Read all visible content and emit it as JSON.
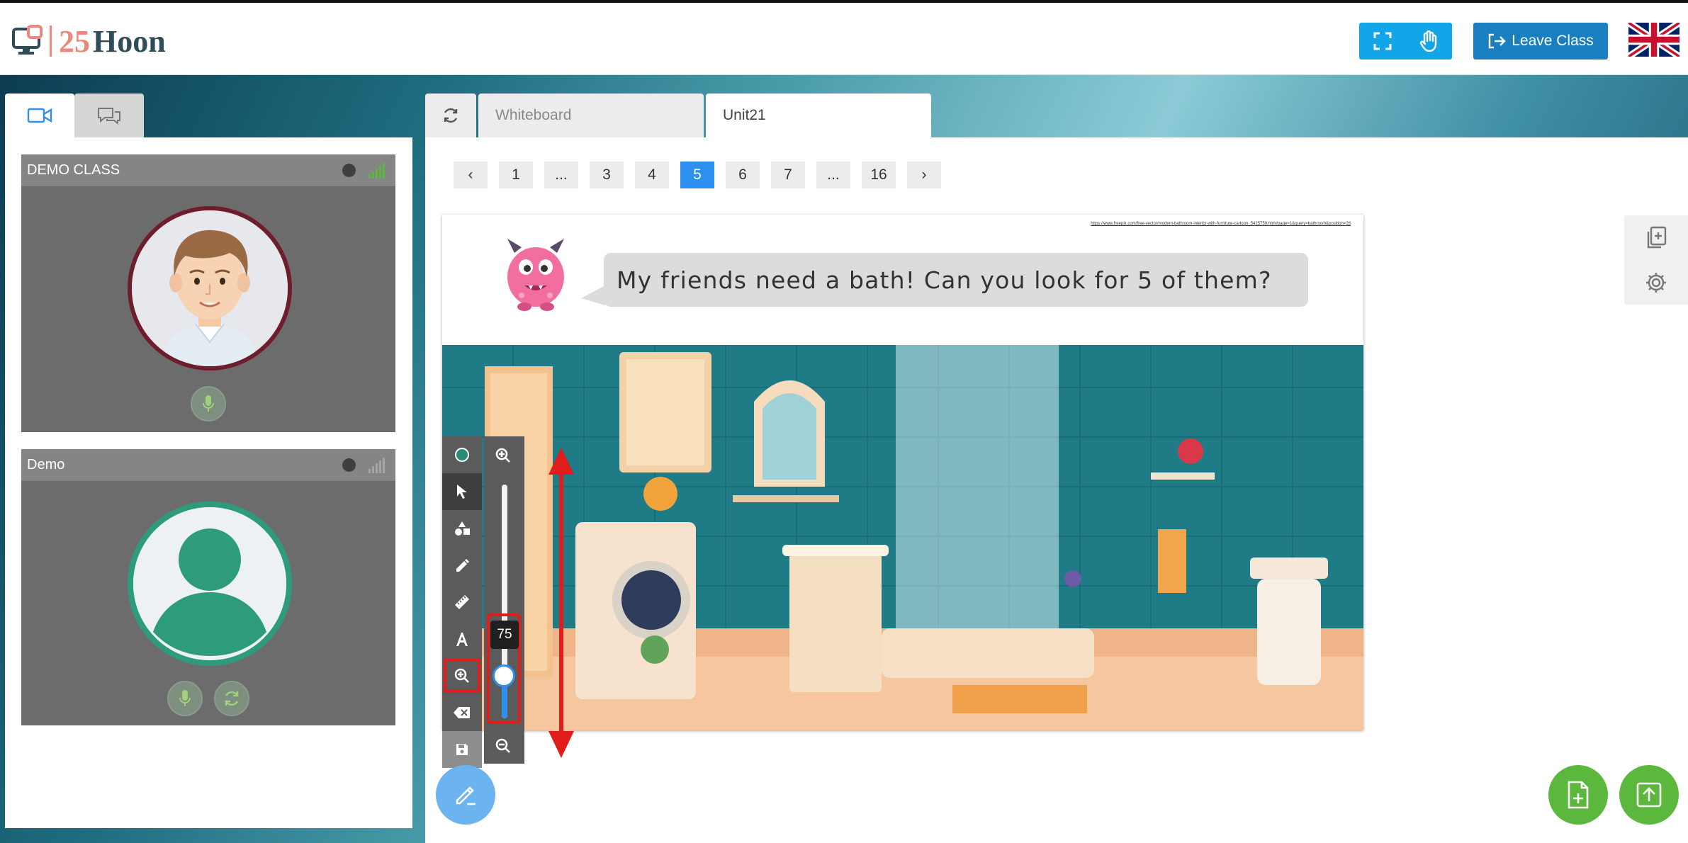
{
  "header": {
    "logo_number": "25",
    "logo_word": "Hoon",
    "leave_label": "Leave Class",
    "fullscreen_icon": "fullscreen-icon",
    "raise_hand_icon": "hand-icon",
    "language_flag": "uk-flag"
  },
  "left_panel": {
    "tabs": [
      {
        "icon": "video-camera-icon"
      },
      {
        "icon": "chat-icon"
      }
    ],
    "cards": [
      {
        "name": "DEMO CLASS",
        "signal_color": "#5cb83d"
      },
      {
        "name": "Demo",
        "signal_color": "#9a9a9a"
      }
    ]
  },
  "main": {
    "tabs": [
      {
        "label": "Whiteboard"
      },
      {
        "label": "Unit21"
      }
    ],
    "pager": {
      "prev": "‹",
      "pages": [
        "1",
        "...",
        "3",
        "4",
        "5",
        "6",
        "7",
        "...",
        "16"
      ],
      "active": "5",
      "next": "›"
    },
    "slide": {
      "source_link": "https://www.freepik.com/free-vector/modern-bathroom-interior-with-furniture-cartoon_5425759.htm#page=1&query=bathroom&position=26",
      "speech": "My friends need a bath! Can you look for 5 of them?"
    },
    "zoom": {
      "value": "75",
      "level": 0.25
    }
  },
  "colors": {
    "accent_blue": "#2d8ff0",
    "header_button": "#1a7fc0",
    "highlight_red": "#e21b1b",
    "fab_green": "#5cb83d"
  }
}
